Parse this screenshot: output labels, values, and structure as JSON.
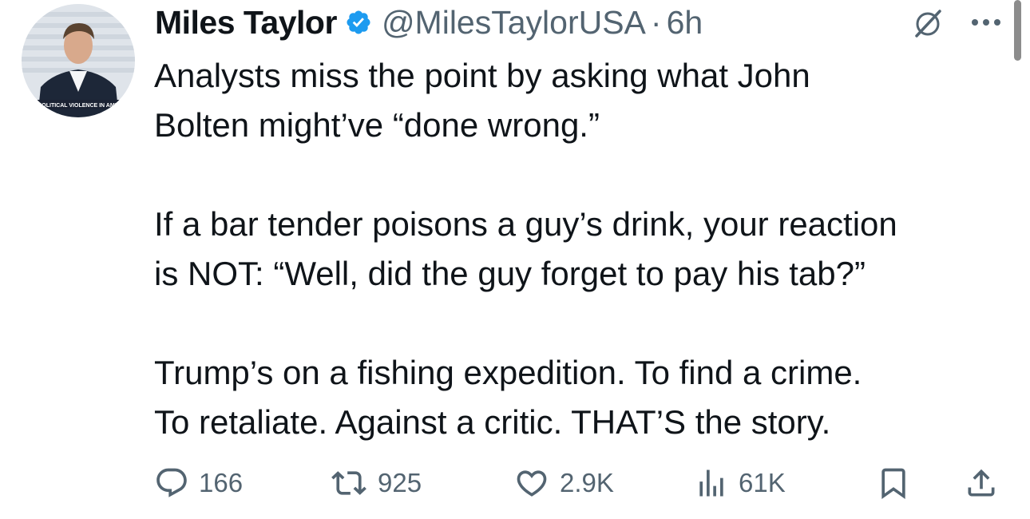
{
  "tweet": {
    "author": {
      "name": "Miles Taylor",
      "handle": "@MilesTaylorUSA",
      "verified": true,
      "avatar_caption": "POLITICAL VIOLENCE IN AME"
    },
    "separator": "·",
    "time": "6h",
    "paragraphs": [
      "Analysts miss the point by asking what John\nBolten might’ve “done wrong.”",
      "If a bar tender poisons a guy’s drink, your reaction\nis NOT: “Well, did the guy forget to pay his tab?”",
      "Trump’s on a fishing expedition. To find a crime.\nTo retaliate. Against a critic. THAT’S the story."
    ],
    "stats": {
      "replies": "166",
      "reposts": "925",
      "likes": "2.9K",
      "views": "61K"
    },
    "icons": {
      "verified": "verified-badge-icon",
      "grok": "grok-icon",
      "more": "more-options-icon",
      "reply": "reply-icon",
      "repost": "repost-icon",
      "like": "heart-icon",
      "views": "views-icon",
      "bookmark": "bookmark-icon",
      "share": "share-icon"
    },
    "colors": {
      "text": "#0f1419",
      "secondary": "#536471",
      "verified": "#1d9bf0"
    }
  }
}
